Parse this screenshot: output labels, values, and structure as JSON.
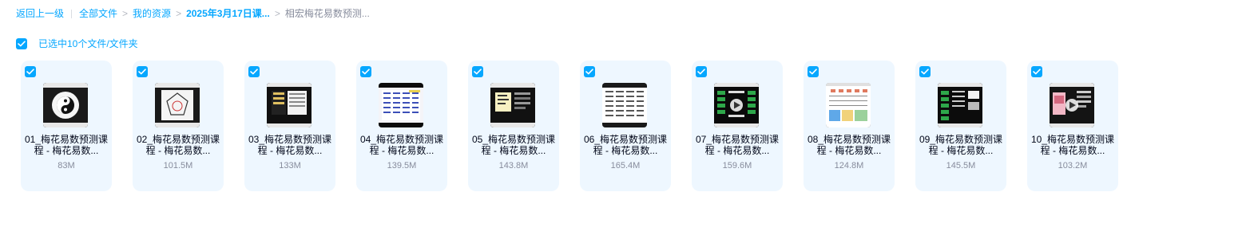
{
  "breadcrumb": {
    "back": "返回上一级",
    "all_files": "全部文件",
    "my_resources": "我的资源",
    "course_folder": "2025年3月17日课...",
    "current": "相宏梅花易数预测..."
  },
  "selection": {
    "label": "已选中10个文件/文件夹"
  },
  "files": [
    {
      "name": "01_梅花易数预测课程 - 梅花易数...",
      "size": "83M"
    },
    {
      "name": "02_梅花易数预测课程 - 梅花易数...",
      "size": "101.5M"
    },
    {
      "name": "03_梅花易数预测课程 - 梅花易数...",
      "size": "133M"
    },
    {
      "name": "04_梅花易数预测课程 - 梅花易数...",
      "size": "139.5M"
    },
    {
      "name": "05_梅花易数预测课程 - 梅花易数...",
      "size": "143.8M"
    },
    {
      "name": "06_梅花易数预测课程 - 梅花易数...",
      "size": "165.4M"
    },
    {
      "name": "07_梅花易数预测课程 - 梅花易数...",
      "size": "159.6M"
    },
    {
      "name": "08_梅花易数预测课程 - 梅花易数...",
      "size": "124.8M"
    },
    {
      "name": "09_梅花易数预测课程 - 梅花易数...",
      "size": "145.5M"
    },
    {
      "name": "10_梅花易数预测课程 - 梅花易数...",
      "size": "103.2M"
    }
  ],
  "colors": {
    "accent": "#06a7ff",
    "card_background": "#eef7ff",
    "secondary_text": "#878c9c"
  },
  "icons": {
    "checkbox": "checkbox-checked-icon",
    "video": "video-thumbnail-icon",
    "play": "play-icon"
  }
}
